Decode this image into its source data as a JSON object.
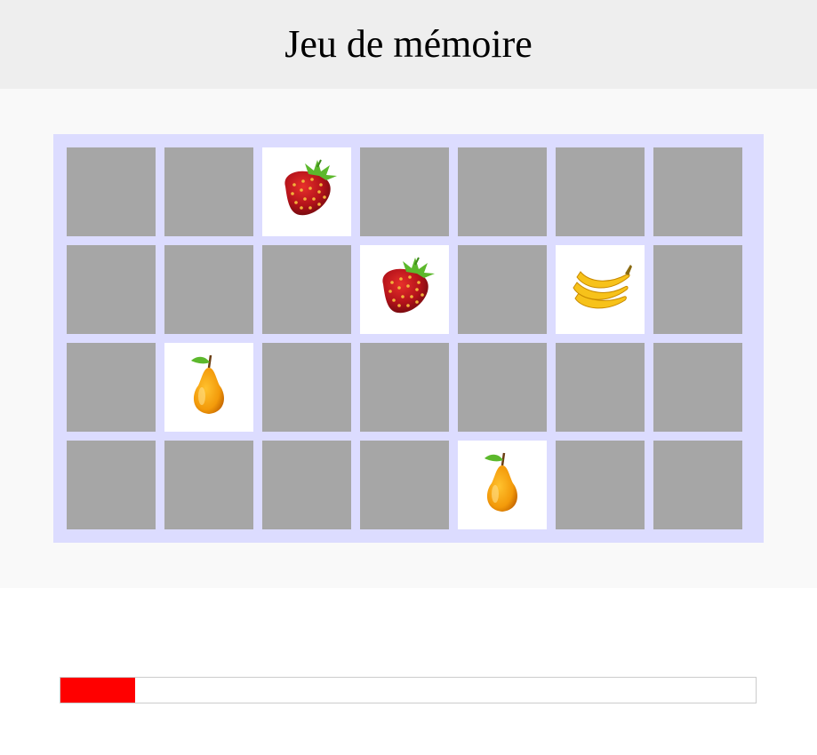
{
  "header": {
    "title": "Jeu de mémoire"
  },
  "board": {
    "rows": 4,
    "cols": 7,
    "hidden_color": "#a6a6a6",
    "revealed_color": "#ffffff",
    "background_color": "#dcdcff",
    "revealed_cards": [
      {
        "row": 0,
        "col": 2,
        "fruit": "strawberry"
      },
      {
        "row": 1,
        "col": 3,
        "fruit": "strawberry"
      },
      {
        "row": 1,
        "col": 5,
        "fruit": "banana"
      },
      {
        "row": 2,
        "col": 1,
        "fruit": "pear"
      },
      {
        "row": 3,
        "col": 4,
        "fruit": "pear"
      }
    ]
  },
  "timer": {
    "progress": 0.107,
    "fill_color": "#ff0000",
    "border_color": "#cccccc"
  }
}
